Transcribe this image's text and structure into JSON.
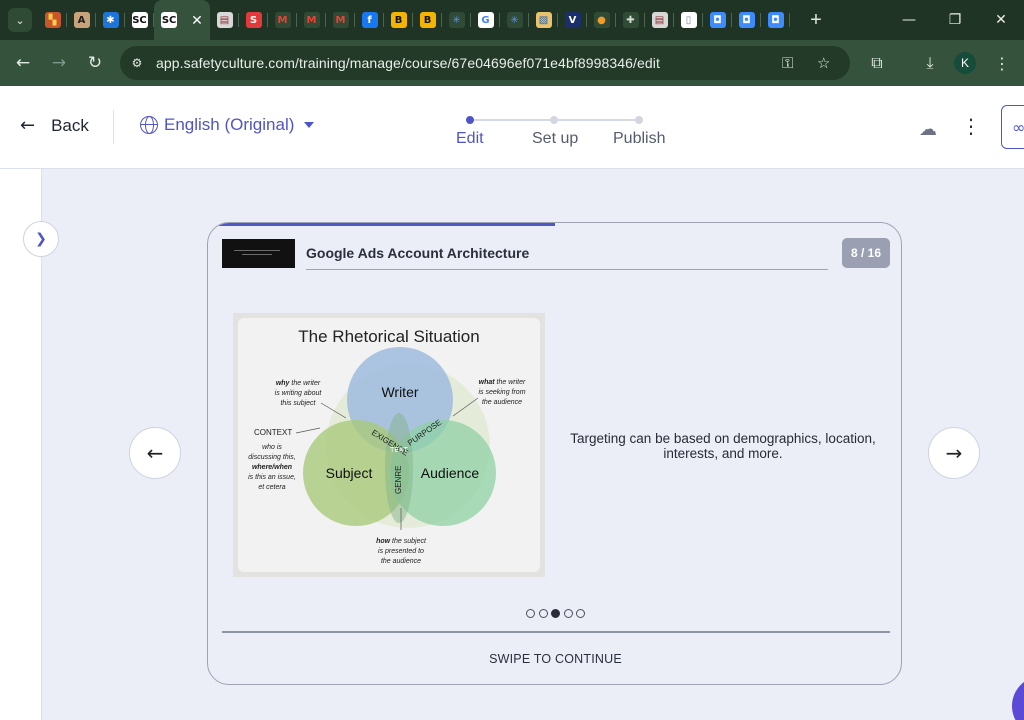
{
  "browser": {
    "tab_list_label": "v",
    "active_tab_close": "✕",
    "tabs": [
      {
        "icon": "stack-favicon",
        "glyph": "▚",
        "color": "#c9552a",
        "text_color": "#ffd24a"
      },
      {
        "icon": "anthropic-favicon",
        "glyph": "A",
        "color": "#c9a27a",
        "text_color": "#1c1c1c"
      },
      {
        "icon": "bluesky-favicon",
        "glyph": "✱",
        "color": "#1d74d9",
        "text_color": "#ffffff"
      },
      {
        "icon": "safetyculture-favicon",
        "glyph": "SC",
        "color": "#ffffff",
        "text_color": "#111111"
      },
      {
        "icon": "safetyculture-favicon",
        "glyph": "SC",
        "color": "#ffffff",
        "text_color": "#111111"
      },
      {
        "icon": "photos-favicon",
        "glyph": "▤",
        "color": "#d8d8d8",
        "text_color": "#8a2a2a"
      },
      {
        "icon": "scribd-favicon",
        "glyph": "S",
        "color": "#e23a3a",
        "text_color": "#ffffff"
      },
      {
        "icon": "gmail-favicon",
        "glyph": "M",
        "color": "#2f4a35",
        "text_color": "#e94235"
      },
      {
        "icon": "gmail-favicon",
        "glyph": "M",
        "color": "#2f4a35",
        "text_color": "#e94235"
      },
      {
        "icon": "gmail-favicon",
        "glyph": "M",
        "color": "#2f4a35",
        "text_color": "#e94235"
      },
      {
        "icon": "facebook-favicon",
        "glyph": "f",
        "color": "#1877f2",
        "text_color": "#ffffff"
      },
      {
        "icon": "b-favicon",
        "glyph": "B",
        "color": "#f4b400",
        "text_color": "#111111"
      },
      {
        "icon": "b-favicon",
        "glyph": "B",
        "color": "#f4b400",
        "text_color": "#111111"
      },
      {
        "icon": "star-favicon",
        "glyph": "✳",
        "color": "#2f4a35",
        "text_color": "#5b8cff"
      },
      {
        "icon": "google-favicon",
        "glyph": "G",
        "color": "#ffffff",
        "text_color": "#4285f4"
      },
      {
        "icon": "star-favicon",
        "glyph": "✳",
        "color": "#2f4a35",
        "text_color": "#5b8cff"
      },
      {
        "icon": "image-favicon",
        "glyph": "▧",
        "color": "#e8c36b",
        "text_color": "#2b5fa8"
      },
      {
        "icon": "v-favicon",
        "glyph": "V",
        "color": "#1b2f6b",
        "text_color": "#ffffff"
      },
      {
        "icon": "orange-favicon",
        "glyph": "●",
        "color": "#2f4a35",
        "text_color": "#f29b2a"
      },
      {
        "icon": "extension-favicon",
        "glyph": "✚",
        "color": "#2f4a35",
        "text_color": "#d5dcd6"
      },
      {
        "icon": "photos-favicon",
        "glyph": "▤",
        "color": "#d8d8d8",
        "text_color": "#8a2a2a"
      },
      {
        "icon": "doc-favicon",
        "glyph": "▯",
        "color": "#ffffff",
        "text_color": "#7a8aa0"
      },
      {
        "icon": "blue-square-favicon",
        "glyph": "◘",
        "color": "#3d8bfd",
        "text_color": "#ffffff"
      },
      {
        "icon": "blue-square-favicon",
        "glyph": "◘",
        "color": "#3d8bfd",
        "text_color": "#ffffff"
      },
      {
        "icon": "blue-square-favicon",
        "glyph": "◘",
        "color": "#3d8bfd",
        "text_color": "#ffffff"
      }
    ],
    "new_tab": "+",
    "minimize": "—",
    "maximize": "❐",
    "close": "✕",
    "back": "←",
    "forward": "→",
    "reload": "↻",
    "url": "app.safetyculture.com/training/manage/course/67e04696ef071e4bf8998346/edit",
    "profile_initial": "K"
  },
  "header": {
    "back_label": "Back",
    "language_label": "English (Original)",
    "steps": [
      {
        "label": "Edit",
        "active": true
      },
      {
        "label": "Set up",
        "active": false
      },
      {
        "label": "Publish",
        "active": false
      }
    ]
  },
  "slide": {
    "title": "Google Ads Account Architecture",
    "counter": "8 / 16",
    "progress_fraction": 0.5,
    "text": "Targeting can be based on demographics, location, interests, and more.",
    "pager_total": 5,
    "pager_active": 3,
    "swipe_label": "SWIPE TO CONTINUE"
  },
  "diagram": {
    "title": "The Rhetorical Situation",
    "writer": "Writer",
    "subject": "Subject",
    "audience": "Audience",
    "exigence": "EXIGENCE",
    "purpose": "PURPOSE",
    "text": "TEXT",
    "genre": "GENRE",
    "context": "CONTEXT",
    "why": "why",
    "why_lines": [
      "the writer",
      "is writing about",
      "this subject"
    ],
    "what": "what",
    "what_lines": [
      "the writer",
      "is seeking from",
      "the audience"
    ],
    "who_lines": [
      "who is",
      "discussing this,",
      "where/when",
      "is this an issue,",
      "et cetera"
    ],
    "how": "how",
    "how_lines": [
      "the subject",
      "is presented to",
      "the audience"
    ]
  },
  "colors": {
    "accent": "#4f55c9",
    "browser_dark": "#1f3424",
    "browser_toolbar": "#35523c",
    "canvas": "#eceef7"
  }
}
